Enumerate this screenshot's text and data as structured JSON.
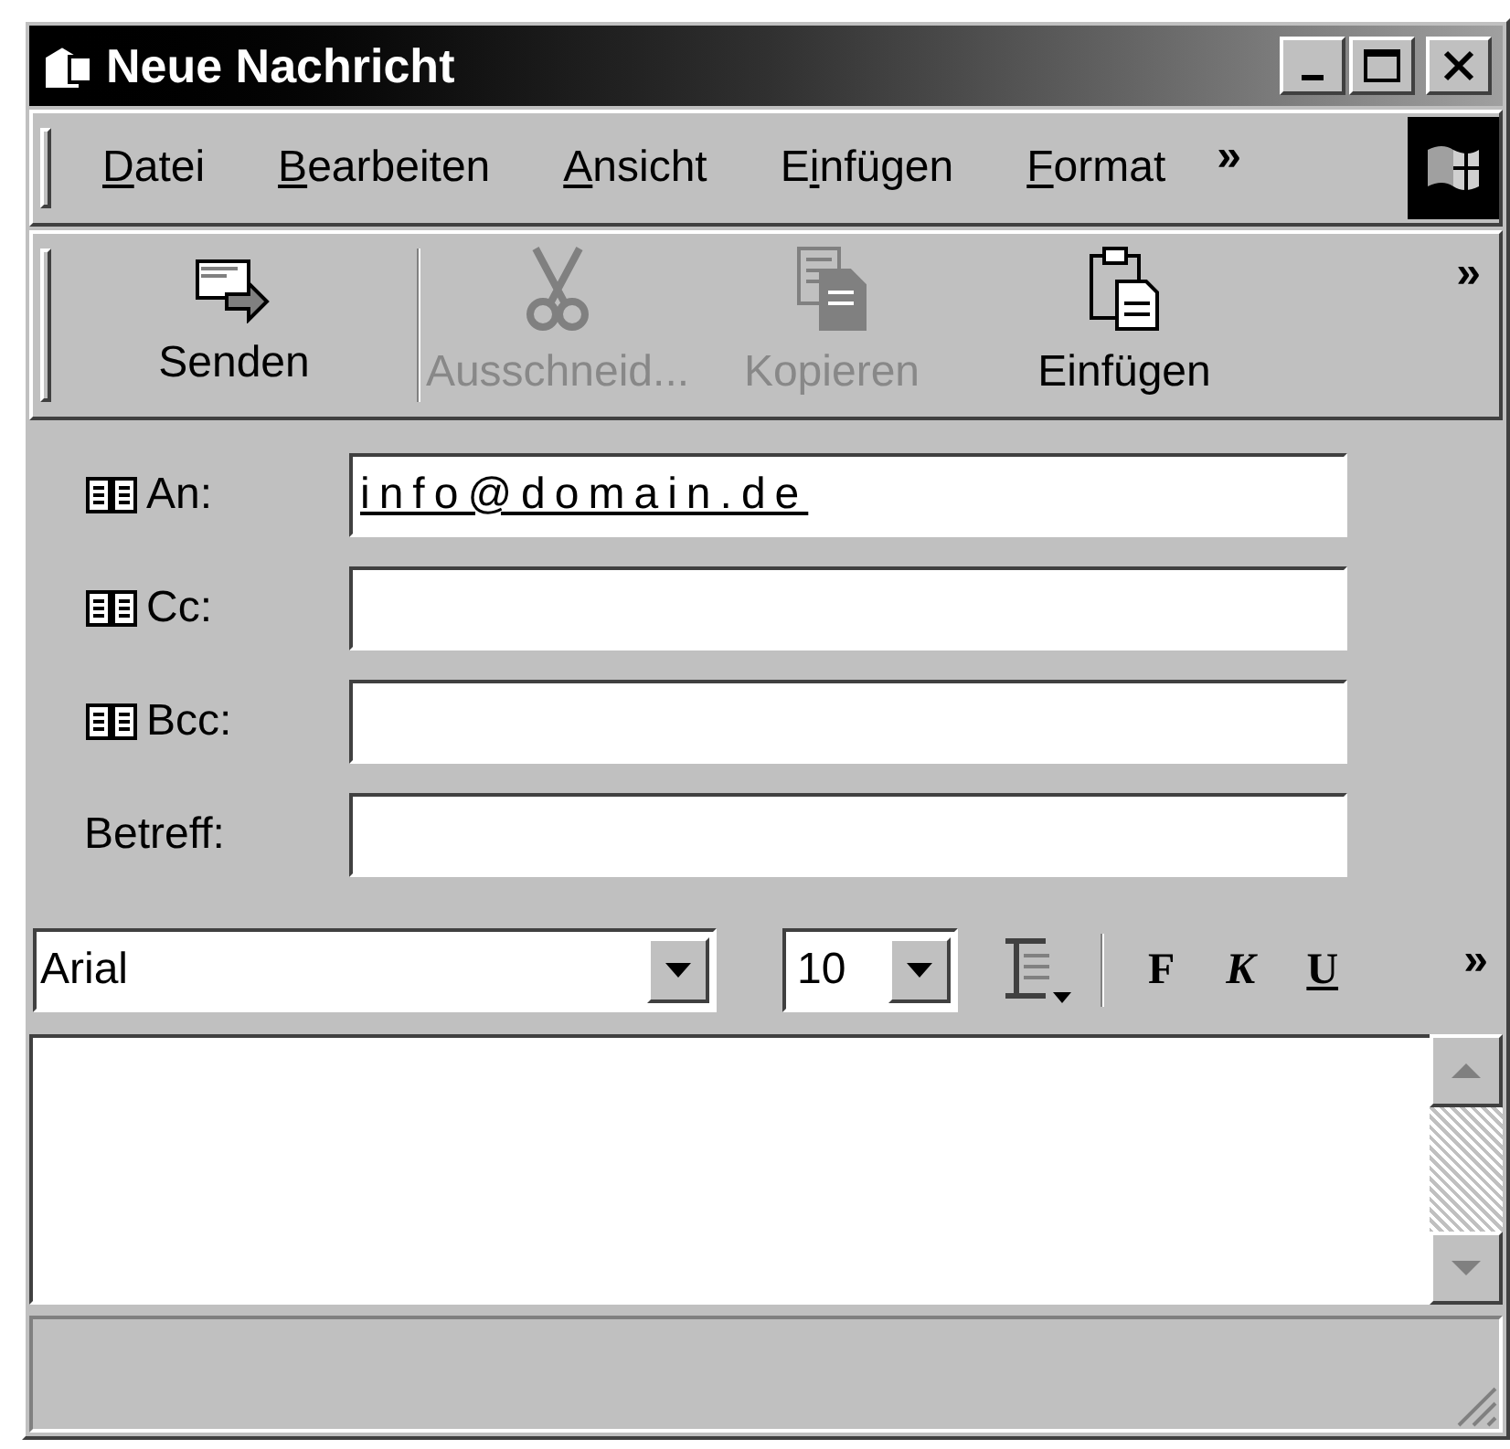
{
  "window": {
    "title": "Neue Nachricht"
  },
  "menu": {
    "items": [
      {
        "parts": [
          {
            "text": "D",
            "underlined": true
          },
          {
            "text": "atei",
            "underlined": false
          }
        ]
      },
      {
        "parts": [
          {
            "text": "B",
            "underlined": true
          },
          {
            "text": "earbeiten",
            "underlined": false
          }
        ]
      },
      {
        "parts": [
          {
            "text": "A",
            "underlined": true
          },
          {
            "text": "nsicht",
            "underlined": false
          }
        ]
      },
      {
        "parts": [
          {
            "text": "E",
            "underlined": false
          },
          {
            "text": "i",
            "underlined": true
          },
          {
            "text": "nfügen",
            "underlined": false
          }
        ]
      },
      {
        "parts": [
          {
            "text": "F",
            "underlined": true
          },
          {
            "text": "ormat",
            "underlined": false
          }
        ]
      }
    ],
    "more": "»"
  },
  "toolbar": {
    "buttons": [
      {
        "label": "Senden",
        "kind": "send",
        "disabled": false
      },
      {
        "label": "Ausschneid...",
        "kind": "cut",
        "disabled": true
      },
      {
        "label": "Kopieren",
        "kind": "copy",
        "disabled": true
      },
      {
        "label": "Einfügen",
        "kind": "paste",
        "disabled": false
      }
    ],
    "more": "»"
  },
  "header": {
    "fields": [
      {
        "label": "An:",
        "address_book": true,
        "value": "info@domain.de"
      },
      {
        "label": "Cc:",
        "address_book": true
      },
      {
        "label": "Bcc:",
        "address_book": true
      },
      {
        "label": "Betreff:",
        "address_book": false
      }
    ]
  },
  "format_bar": {
    "font": "Arial",
    "size": "10",
    "bold": "F",
    "italic": "K",
    "underline": "U",
    "more": "»"
  }
}
